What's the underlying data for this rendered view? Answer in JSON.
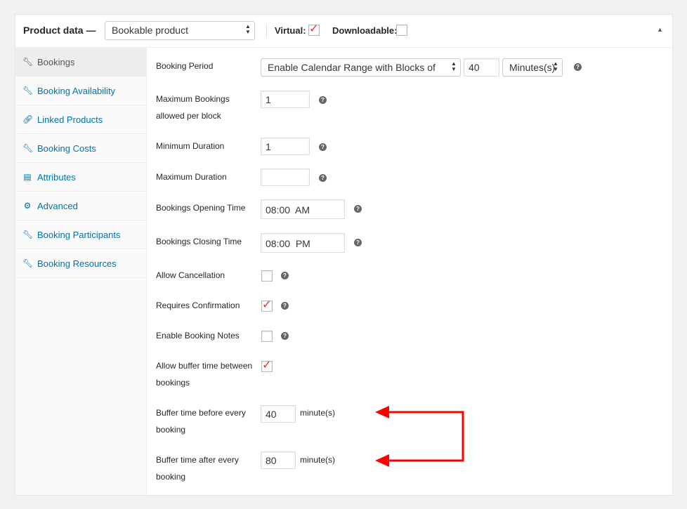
{
  "header": {
    "title": "Product data —",
    "product_type": "Bookable product",
    "virtual_label": "Virtual:",
    "virtual_checked": true,
    "downloadable_label": "Downloadable:",
    "downloadable_checked": false
  },
  "sidebar": {
    "items": [
      {
        "label": "Bookings",
        "icon": "wrench-icon",
        "active": true
      },
      {
        "label": "Booking Availability",
        "icon": "wrench-icon"
      },
      {
        "label": "Linked Products",
        "icon": "link-icon"
      },
      {
        "label": "Booking Costs",
        "icon": "wrench-icon"
      },
      {
        "label": "Attributes",
        "icon": "table-icon"
      },
      {
        "label": "Advanced",
        "icon": "gear-icon"
      },
      {
        "label": "Booking Participants",
        "icon": "wrench-icon"
      },
      {
        "label": "Booking Resources",
        "icon": "wrench-icon"
      }
    ]
  },
  "form": {
    "booking_period": {
      "label": "Booking Period",
      "mode": "Enable Calendar Range with Blocks of",
      "block_size": "40",
      "unit": "Minutes(s)"
    },
    "max_bookings": {
      "label_line1": "Maximum Bookings",
      "label_line2": "allowed per block",
      "value": "1"
    },
    "min_duration": {
      "label": "Minimum Duration",
      "value": "1"
    },
    "max_duration": {
      "label": "Maximum Duration",
      "value": ""
    },
    "opening_time": {
      "label": "Bookings Opening Time",
      "value": "08:00  AM"
    },
    "closing_time": {
      "label": "Bookings Closing Time",
      "value": "08:00  PM"
    },
    "allow_cancellation": {
      "label": "Allow Cancellation",
      "checked": false
    },
    "requires_confirmation": {
      "label": "Requires Confirmation",
      "checked": true
    },
    "enable_notes": {
      "label": "Enable Booking Notes",
      "checked": false
    },
    "allow_buffer": {
      "label_line1": "Allow buffer time between",
      "label_line2": "bookings",
      "checked": true
    },
    "buffer_before": {
      "label_line1": "Buffer time before every",
      "label_line2": "booking",
      "value": "40",
      "unit": "minute(s)"
    },
    "buffer_after": {
      "label_line1": "Buffer time after every",
      "label_line2": "booking",
      "value": "80",
      "unit": "minute(s)"
    },
    "help_glyph": "?"
  },
  "colors": {
    "accent": "#0073aa",
    "annotation_arrow": "#ff0000",
    "check": "#dd3333"
  }
}
